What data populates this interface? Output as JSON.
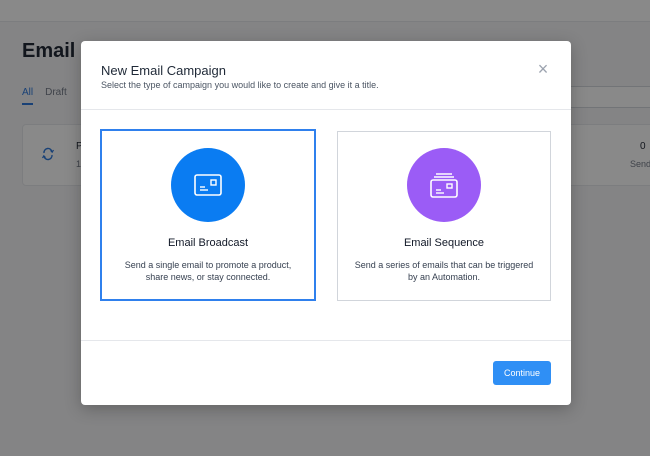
{
  "background": {
    "page_title": "Email C",
    "tabs": [
      {
        "label": "All"
      },
      {
        "label": "Draft"
      }
    ],
    "row": {
      "name": "P",
      "sub": "1",
      "count": "0",
      "sent_label": "Send"
    }
  },
  "modal": {
    "title": "New Email Campaign",
    "subtitle": "Select the type of campaign you would like to create and give it a title.",
    "close_glyph": "×",
    "options": [
      {
        "title": "Email Broadcast",
        "description": "Send a single email to promote a product, share news, or stay connected.",
        "icon": "card-icon",
        "color": "#0a7cf2",
        "selected": true
      },
      {
        "title": "Email Sequence",
        "description": "Send a series of emails that can be triggered by an Automation.",
        "icon": "stacked-cards-icon",
        "color": "#9b5cf6",
        "selected": false
      }
    ],
    "continue_label": "Continue"
  },
  "colors": {
    "accent": "#2f80ed",
    "button": "#2f8ff5"
  }
}
